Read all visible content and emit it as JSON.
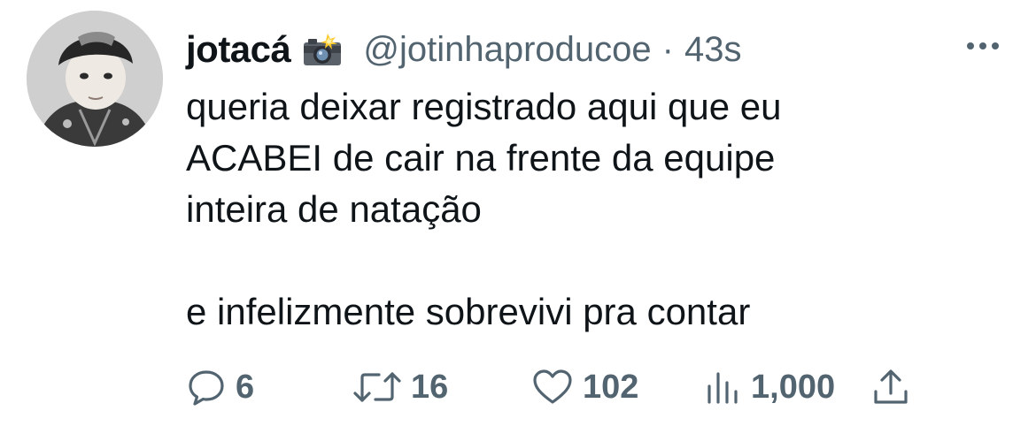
{
  "tweet": {
    "display_name": "jotacá",
    "handle": "@jotinhaproducoe",
    "separator": "·",
    "time": "43s",
    "text_lines": [
      "queria deixar registrado aqui que eu",
      "ACABEI de cair na frente da equipe",
      "inteira de natação",
      "e infelizmente sobrevivi pra contar"
    ],
    "name_emoji_icon": "camera-flash-icon"
  },
  "actions": {
    "replies": "6",
    "retweets": "16",
    "likes": "102",
    "views": "1,000"
  },
  "colors": {
    "text": "#0f1419",
    "secondary": "#536471",
    "background": "#ffffff"
  }
}
